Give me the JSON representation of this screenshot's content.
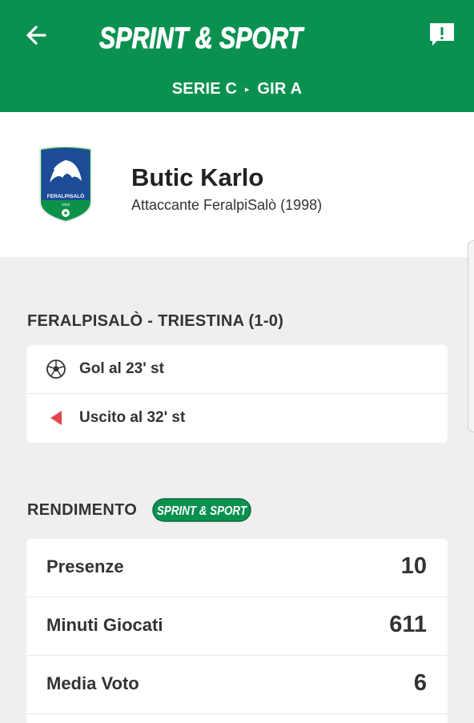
{
  "header": {
    "brand": "SPRINT & SPORT",
    "breadcrumb": {
      "league": "SERIE C",
      "separator": "▸",
      "group": "GIR A"
    },
    "colors": {
      "primary": "#0a9150"
    },
    "icons": {
      "back": "arrow-left-icon",
      "report": "feedback-alert-icon"
    }
  },
  "player": {
    "name": "Butic Karlo",
    "info": "Attaccante FeralpiSalò (1998)",
    "team_crest": {
      "text": "FERALPISALÒ",
      "year": "2009",
      "icon": "team-crest-icon"
    }
  },
  "match": {
    "title": "FERALPISALÒ - TRIESTINA (1-0)",
    "events": [
      {
        "icon": "soccer-ball-icon",
        "label": "Gol al 23' st"
      },
      {
        "icon": "substitution-out-icon",
        "label": "Uscito al 32' st"
      }
    ]
  },
  "rendimento": {
    "title": "RENDIMENTO",
    "badge": "SPRINT & SPORT",
    "stats": [
      {
        "label": "Presenze",
        "value": "10"
      },
      {
        "label": "Minuti Giocati",
        "value": "611"
      },
      {
        "label": "Media Voto",
        "value": "6"
      }
    ]
  }
}
